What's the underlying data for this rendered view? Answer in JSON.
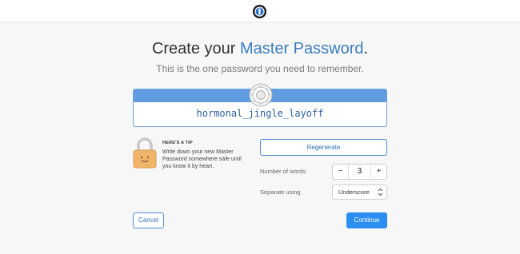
{
  "topbar": {
    "logo_icon": "1password-logo-icon"
  },
  "header": {
    "title_prefix": "Create your ",
    "title_accent": "Master Password",
    "title_suffix": ".",
    "subtitle": "This is the one password you need to remember."
  },
  "password": {
    "value": "hormonal_jingle_layoff",
    "icon": "vault-icon",
    "band_color": "#5f9de0"
  },
  "tip": {
    "icon": "padlock-icon",
    "heading": "HERE'S A TIP",
    "body": "Write down your new Master Password somewhere safe until you know it by heart."
  },
  "controls": {
    "regenerate_label": "Regenerate",
    "words_label": "Number of words",
    "words_minus": "−",
    "words_count": "3",
    "words_plus": "+",
    "separator_label": "Separate using",
    "separator_value": "Underscore"
  },
  "footer": {
    "cancel_label": "Cancel",
    "continue_label": "Continue"
  },
  "colors": {
    "accent": "#3b7dbf",
    "primary_button": "#2b8ef0",
    "background": "#f7f7f7"
  }
}
